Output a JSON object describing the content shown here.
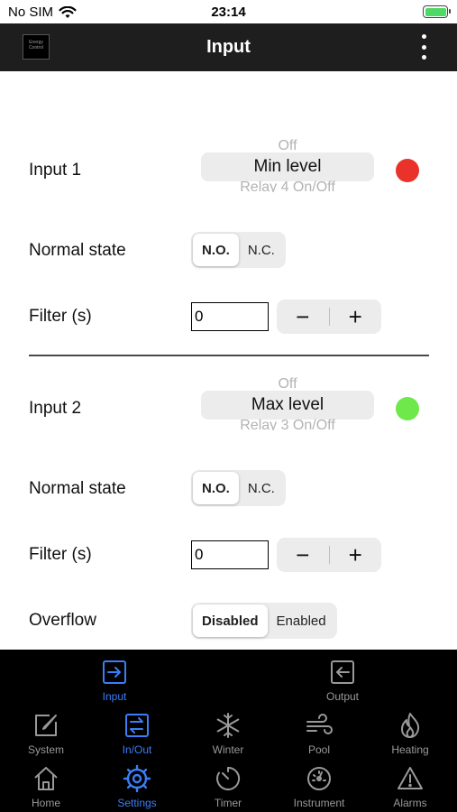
{
  "status_bar": {
    "carrier": "No SIM",
    "time": "23:14"
  },
  "nav": {
    "title": "Input",
    "logo_text": "Energy Control"
  },
  "input1": {
    "label": "Input 1",
    "picker_above": "Off",
    "picker_selected": "Min level",
    "picker_below": "Relay 4 On/Off",
    "status_color": "#e8322a",
    "normal_state_label": "Normal state",
    "normal_state_options": [
      "N.O.",
      "N.C."
    ],
    "normal_state_selected": "N.O.",
    "filter_label": "Filter (s)",
    "filter_value": "0",
    "minus_label": "−",
    "plus_label": "+"
  },
  "input2": {
    "label": "Input 2",
    "picker_above": "Off",
    "picker_selected": "Max level",
    "picker_below": "Relay 3 On/Off",
    "status_color": "#6ee84a",
    "normal_state_label": "Normal state",
    "normal_state_options": [
      "N.O.",
      "N.C."
    ],
    "normal_state_selected": "N.O.",
    "filter_label": "Filter (s)",
    "filter_value": "0",
    "minus_label": "−",
    "plus_label": "+",
    "overflow_label": "Overflow",
    "overflow_options": [
      "Disabled",
      "Enabled"
    ],
    "overflow_selected": "Disabled"
  },
  "subtabs": [
    {
      "label": "Input",
      "icon": "arrow-right-box-icon",
      "selected": true
    },
    {
      "label": "Output",
      "icon": "arrow-left-box-icon",
      "selected": false
    }
  ],
  "category_tabs": [
    {
      "label": "System",
      "icon": "edit-icon",
      "selected": false
    },
    {
      "label": "In/Out",
      "icon": "swap-icon",
      "selected": true
    },
    {
      "label": "Winter",
      "icon": "snowflake-icon",
      "selected": false
    },
    {
      "label": "Pool",
      "icon": "wind-icon",
      "selected": false
    },
    {
      "label": "Heating",
      "icon": "flame-icon",
      "selected": false
    }
  ],
  "main_tabs": [
    {
      "label": "Home",
      "icon": "home-icon",
      "selected": false
    },
    {
      "label": "Settings",
      "icon": "gear-icon",
      "selected": true
    },
    {
      "label": "Timer",
      "icon": "timer-icon",
      "selected": false
    },
    {
      "label": "Instrument",
      "icon": "gauge-icon",
      "selected": false
    },
    {
      "label": "Alarms",
      "icon": "warning-icon",
      "selected": false
    }
  ],
  "colors": {
    "accent": "#3b7ef5",
    "nav_bg": "#1e1e1e",
    "tab_bg": "#000000",
    "inactive": "#999999"
  }
}
